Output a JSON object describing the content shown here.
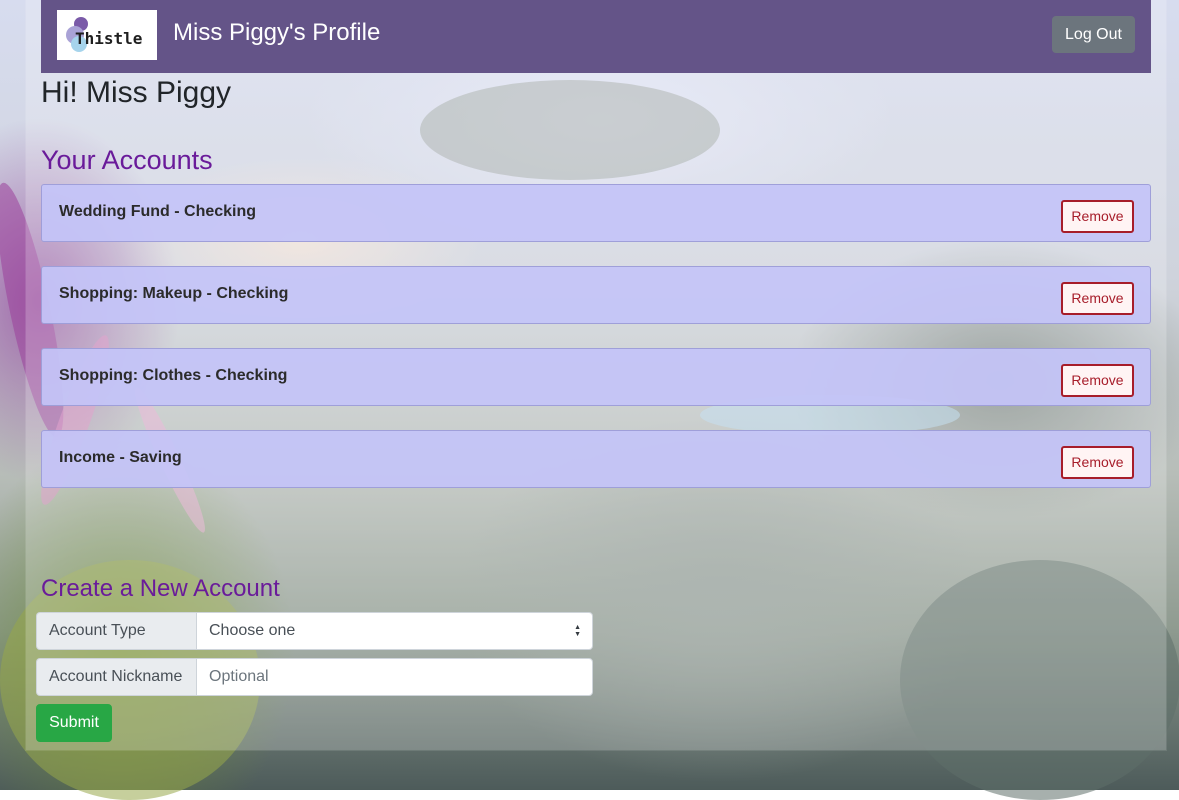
{
  "header": {
    "logo_text": "Thistle",
    "title": "Miss Piggy's Profile",
    "logout_label": "Log Out"
  },
  "greeting": "Hi! Miss Piggy",
  "accounts_section": {
    "heading": "Your Accounts",
    "remove_label": "Remove",
    "items": [
      {
        "name": "Wedding Fund - Checking"
      },
      {
        "name": "Shopping: Makeup - Checking"
      },
      {
        "name": "Shopping: Clothes - Checking"
      },
      {
        "name": "Income - Saving"
      }
    ]
  },
  "create_section": {
    "heading": "Create a New Account",
    "account_type_label": "Account Type",
    "account_type_selected": "Choose one",
    "nickname_label": "Account Nickname",
    "nickname_placeholder": "Optional",
    "nickname_value": "",
    "submit_label": "Submit"
  },
  "colors": {
    "navbar": "#645488",
    "heading_purple": "#6a1b9a",
    "account_bg": "#c4c4f8",
    "remove_red": "#a71d2a",
    "submit_green": "#28a745",
    "logout_gray": "#6c757d"
  }
}
